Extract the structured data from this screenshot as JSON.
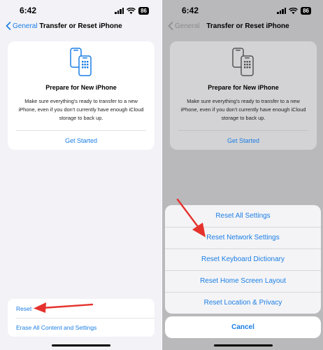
{
  "status": {
    "time": "6:42",
    "battery": "86"
  },
  "nav": {
    "back_label": "General",
    "title": "Transfer or Reset iPhone"
  },
  "card": {
    "title": "Prepare for New iPhone",
    "description": "Make sure everything's ready to transfer to a new iPhone, even if you don't currently have enough iCloud storage to back up.",
    "link": "Get Started"
  },
  "reset_group": {
    "reset": "Reset",
    "erase": "Erase All Content and Settings"
  },
  "action_sheet": {
    "items": [
      "Reset All Settings",
      "Reset Network Settings",
      "Reset Keyboard Dictionary",
      "Reset Home Screen Layout",
      "Reset Location & Privacy"
    ],
    "cancel": "Cancel"
  },
  "colors": {
    "accent": "#1a7ee6",
    "annotation": "#e5322d"
  }
}
